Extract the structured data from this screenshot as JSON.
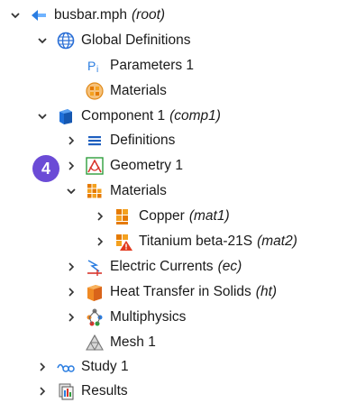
{
  "tree": {
    "root": {
      "label": "busbar.mph",
      "tag": "(root)"
    },
    "global_definitions": {
      "label": "Global Definitions"
    },
    "parameters": {
      "label": "Parameters 1"
    },
    "global_materials": {
      "label": "Materials"
    },
    "component": {
      "label": "Component 1",
      "tag": "(comp1)"
    },
    "definitions": {
      "label": "Definitions"
    },
    "geometry": {
      "label": "Geometry 1"
    },
    "materials": {
      "label": "Materials"
    },
    "copper": {
      "label": "Copper",
      "tag": "(mat1)"
    },
    "titanium": {
      "label": "Titanium beta-21S",
      "tag": "(mat2)"
    },
    "electric_currents": {
      "label": "Electric Currents",
      "tag": "(ec)"
    },
    "heat_transfer": {
      "label": "Heat Transfer in Solids",
      "tag": "(ht)"
    },
    "multiphysics": {
      "label": "Multiphysics"
    },
    "mesh": {
      "label": "Mesh 1"
    },
    "study": {
      "label": "Study 1"
    },
    "results": {
      "label": "Results"
    }
  },
  "step_badge": "4",
  "colors": {
    "badge": "#6b4bd6",
    "accent_blue": "#1e6fd9",
    "material_orange": "#f09a1a"
  }
}
